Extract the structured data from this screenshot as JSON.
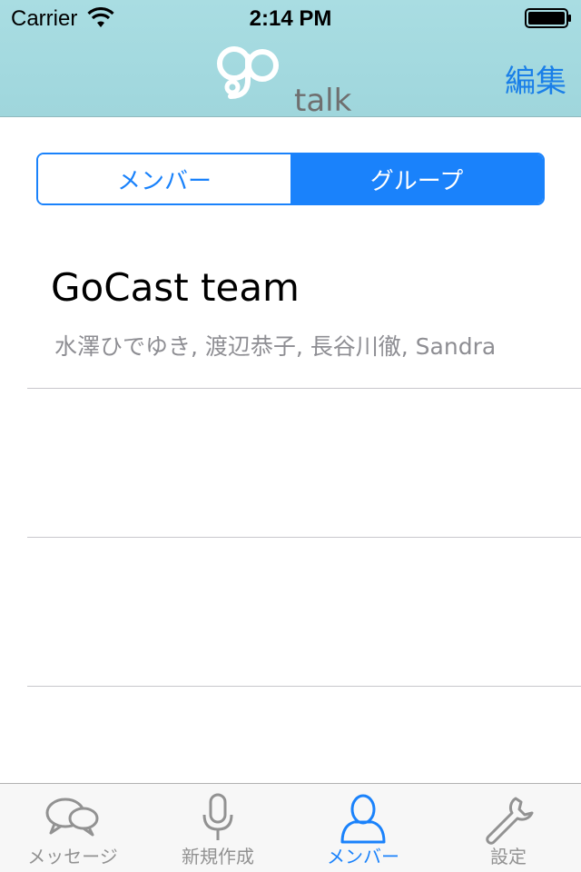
{
  "status_bar": {
    "carrier": "Carrier",
    "time": "2:14 PM"
  },
  "header": {
    "logo_text": "go talk",
    "edit_label": "編集"
  },
  "segments": {
    "members": "メンバー",
    "groups": "グループ",
    "selected": "groups"
  },
  "groups": [
    {
      "name": "GoCast team",
      "members": "水澤ひでゆき, 渡辺恭子, 長谷川徹, Sandra"
    }
  ],
  "tabbar": {
    "tabs": [
      {
        "label": "メッセージ",
        "icon": "chat-bubbles-icon"
      },
      {
        "label": "新規作成",
        "icon": "microphone-icon"
      },
      {
        "label": "メンバー",
        "icon": "person-icon"
      },
      {
        "label": "設定",
        "icon": "wrench-icon"
      }
    ],
    "selected_index": 2
  },
  "colors": {
    "accent": "#1a82fb",
    "header_bg": "#a9dde2",
    "inactive_tab": "#929292"
  }
}
